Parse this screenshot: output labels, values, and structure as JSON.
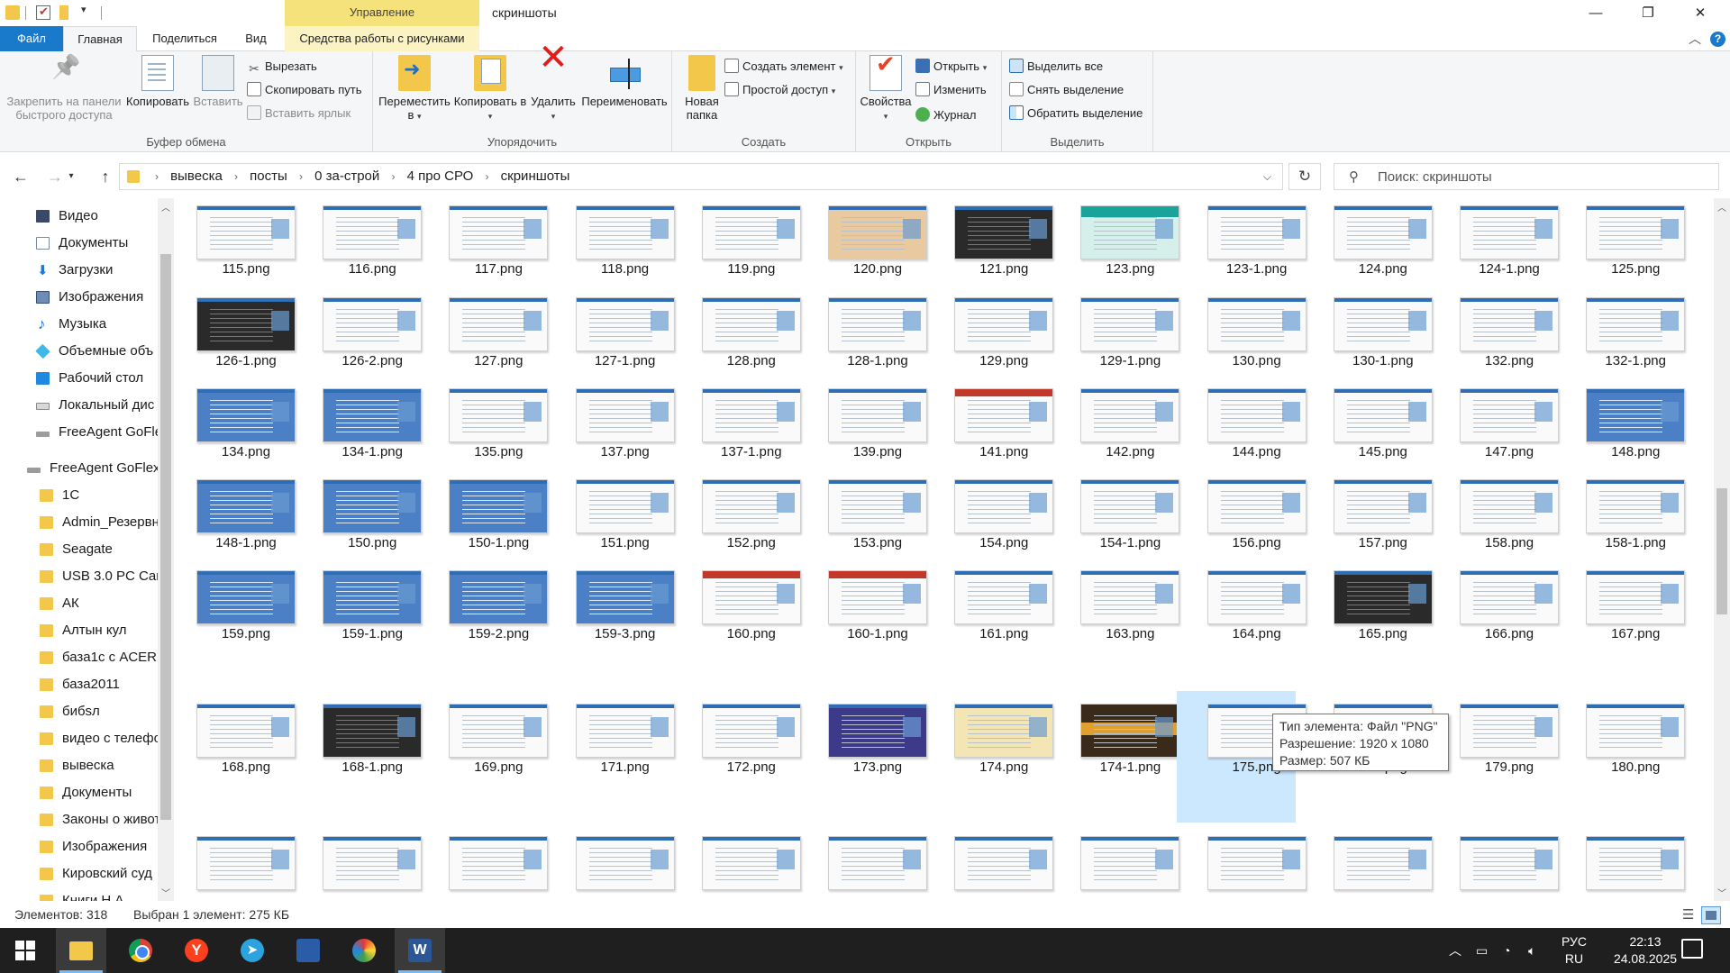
{
  "title_bar": {
    "context_tab": "Управление",
    "window_title": "скриншоты",
    "minimize": "—",
    "maximize": "❐",
    "close": "✕"
  },
  "tabs": {
    "file": "Файл",
    "home": "Главная",
    "share": "Поделиться",
    "view": "Вид",
    "picture_tools": "Средства работы с рисунками"
  },
  "ribbon": {
    "clipboard": {
      "label": "Буфер обмена",
      "pin": "Закрепить на панели быстрого доступа",
      "copy": "Копировать",
      "paste": "Вставить",
      "cut": "Вырезать",
      "copy_path": "Скопировать путь",
      "paste_shortcut": "Вставить ярлык"
    },
    "organize": {
      "label": "Упорядочить",
      "move_to": "Переместить в",
      "copy_to": "Копировать в",
      "delete": "Удалить",
      "rename": "Переименовать"
    },
    "new": {
      "label": "Создать",
      "new_folder": "Новая папка",
      "new_item": "Создать элемент",
      "easy_access": "Простой доступ"
    },
    "open": {
      "label": "Открыть",
      "properties": "Свойства",
      "open": "Открыть",
      "edit": "Изменить",
      "history": "Журнал"
    },
    "select": {
      "label": "Выделить",
      "select_all": "Выделить все",
      "select_none": "Снять выделение",
      "invert": "Обратить выделение"
    }
  },
  "address": {
    "crumbs": [
      "вывеска",
      "посты",
      "0 за-строй",
      "4 про СРО",
      "скриншоты"
    ],
    "search_placeholder": "Поиск: скриншоты"
  },
  "nav_pane": [
    {
      "label": "Видео",
      "icon": "video-icon"
    },
    {
      "label": "Документы",
      "icon": "documents-icon"
    },
    {
      "label": "Загрузки",
      "icon": "downloads-icon"
    },
    {
      "label": "Изображения",
      "icon": "pictures-icon"
    },
    {
      "label": "Музыка",
      "icon": "music-icon"
    },
    {
      "label": "Объемные объ",
      "icon": "3d-objects-icon"
    },
    {
      "label": "Рабочий стол",
      "icon": "desktop-icon"
    },
    {
      "label": "Локальный дис",
      "icon": "local-disk-icon"
    },
    {
      "label": "FreeAgent GoFle",
      "icon": "drive-icon"
    },
    {
      "label": "FreeAgent GoFlex",
      "icon": "drive-icon"
    },
    {
      "label": "1С",
      "icon": "folder-icon"
    },
    {
      "label": "Admin_Резервн",
      "icon": "folder-icon"
    },
    {
      "label": "Seagate",
      "icon": "folder-icon"
    },
    {
      "label": "USB 3.0 PC Card",
      "icon": "folder-icon"
    },
    {
      "label": "АК",
      "icon": "folder-icon"
    },
    {
      "label": "Алтын кул",
      "icon": "folder-icon"
    },
    {
      "label": "база1с с ACER",
      "icon": "folder-icon"
    },
    {
      "label": "база2011",
      "icon": "folder-icon"
    },
    {
      "label": "бибsл",
      "icon": "folder-icon"
    },
    {
      "label": "видео с телефо",
      "icon": "folder-icon"
    },
    {
      "label": "вывеска",
      "icon": "folder-icon"
    },
    {
      "label": "Документы",
      "icon": "folder-icon"
    },
    {
      "label": "Законы о живот",
      "icon": "folder-icon"
    },
    {
      "label": "Изображения",
      "icon": "folder-icon"
    },
    {
      "label": "Кировский суд",
      "icon": "folder-icon"
    },
    {
      "label": "Книги Н.А",
      "icon": "folder-icon"
    }
  ],
  "files": [
    [
      "115.png",
      "116.png",
      "117.png",
      "118.png",
      "119.png",
      "120.png",
      "121.png",
      "123.png",
      "123-1.png",
      "124.png",
      "124-1.png",
      "125.png"
    ],
    [
      "126-1.png",
      "126-2.png",
      "127.png",
      "127-1.png",
      "128.png",
      "128-1.png",
      "129.png",
      "129-1.png",
      "130.png",
      "130-1.png",
      "132.png",
      "132-1.png"
    ],
    [
      "134.png",
      "134-1.png",
      "135.png",
      "137.png",
      "137-1.png",
      "139.png",
      "141.png",
      "142.png",
      "144.png",
      "145.png",
      "147.png",
      "148.png"
    ],
    [
      "148-1.png",
      "150.png",
      "150-1.png",
      "151.png",
      "152.png",
      "153.png",
      "154.png",
      "154-1.png",
      "156.png",
      "157.png",
      "158.png",
      "158-1.png"
    ],
    [
      "159.png",
      "159-1.png",
      "159-2.png",
      "159-3.png",
      "160.png",
      "160-1.png",
      "161.png",
      "163.png",
      "164.png",
      "165.png",
      "166.png",
      "167.png"
    ],
    [
      "168.png",
      "168-1.png",
      "169.png",
      "171.png",
      "172.png",
      "173.png",
      "174.png",
      "174-1.png",
      "175.png",
      "176.png",
      "179.png",
      "180.png"
    ],
    [
      "",
      "",
      "",
      "",
      "",
      "",
      "",
      "",
      "",
      "",
      "",
      ""
    ]
  ],
  "tooltip": {
    "type": "Тип элемента: Файл \"PNG\"",
    "resolution": "Разрешение: 1920 x 1080",
    "size": "Размер: 507 КБ"
  },
  "status": {
    "count": "Элементов: 318",
    "selected": "Выбран 1 элемент: 275 КБ"
  },
  "taskbar": {
    "lang_top": "РУС",
    "lang_bottom": "RU",
    "time": "22:13",
    "date": "24.08.2025"
  },
  "colors": {
    "accent": "#1979ca",
    "context_tab": "#f5e27a",
    "selection": "#cce8ff",
    "taskbar": "#1f1f1f"
  }
}
